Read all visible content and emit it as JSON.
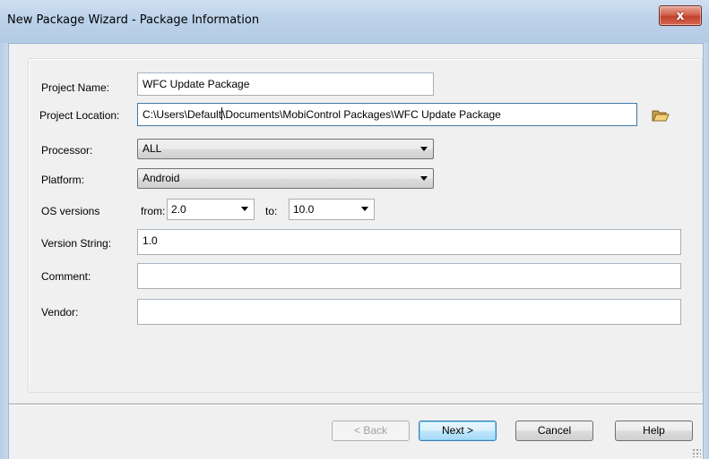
{
  "window": {
    "title": "New Package Wizard - Package Information",
    "close_glyph": "x"
  },
  "form": {
    "project_name_label": "Project Name:",
    "project_name_value": "WFC Update Package",
    "project_location_label": "Project Location:",
    "project_location_value_before_caret": "C:\\Users\\Default",
    "project_location_value_after_caret": "\\Documents\\MobiControl Packages\\WFC Update Package",
    "processor_label": "Processor:",
    "processor_value": "ALL",
    "platform_label": "Platform:",
    "platform_value": "Android",
    "os_versions_label": "OS versions",
    "os_from_label": "from:",
    "os_from_value": "2.0",
    "os_to_label": "to:",
    "os_to_value": "10.0",
    "version_string_label": "Version String:",
    "version_string_value": "1.0",
    "comment_label": "Comment:",
    "comment_value": "",
    "vendor_label": "Vendor:",
    "vendor_value": ""
  },
  "buttons": {
    "back_label": "< Back",
    "next_label": "Next >",
    "cancel_label": "Cancel",
    "help_label": "Help"
  },
  "icons": {
    "browse": "folder-open-icon",
    "dropdown": "chevron-down-icon",
    "close": "close-icon"
  },
  "colors": {
    "titlebar": "#bcd2ea",
    "close_button": "#c2412b",
    "client_background": "#f0f0f0",
    "default_button_border": "#3c7fb1"
  }
}
